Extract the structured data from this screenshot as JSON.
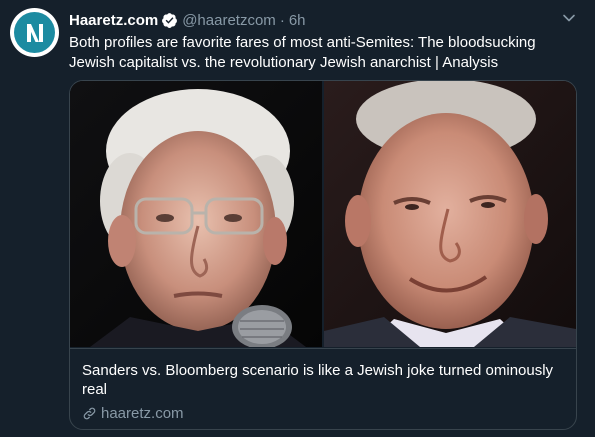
{
  "tweet": {
    "author": {
      "display_name": "Haaretz.com",
      "handle": "@haaretzcom",
      "verified": true,
      "avatar_icon": "haaretz-logo"
    },
    "separator": "·",
    "time": "6h",
    "text": "Both profiles are favorite fares of most anti-Semites: The bloodsucking Jewish capitalist vs. the revolutionary Jewish anarchist | Analysis",
    "menu_icon": "chevron-down-icon",
    "card": {
      "images": [
        "photo-of-bernie-sanders",
        "photo-of-michael-bloomberg"
      ],
      "title": "Sanders vs. Bloomberg scenario is like a Jewish joke turned ominously real",
      "link_icon": "link-icon",
      "domain": "haaretz.com"
    }
  },
  "colors": {
    "background": "#15202b",
    "text_primary": "#ffffff",
    "text_secondary": "#8899a6",
    "border": "#38444d",
    "verified_badge": "#ffffff",
    "avatar_bg": "#1c8ba1"
  }
}
